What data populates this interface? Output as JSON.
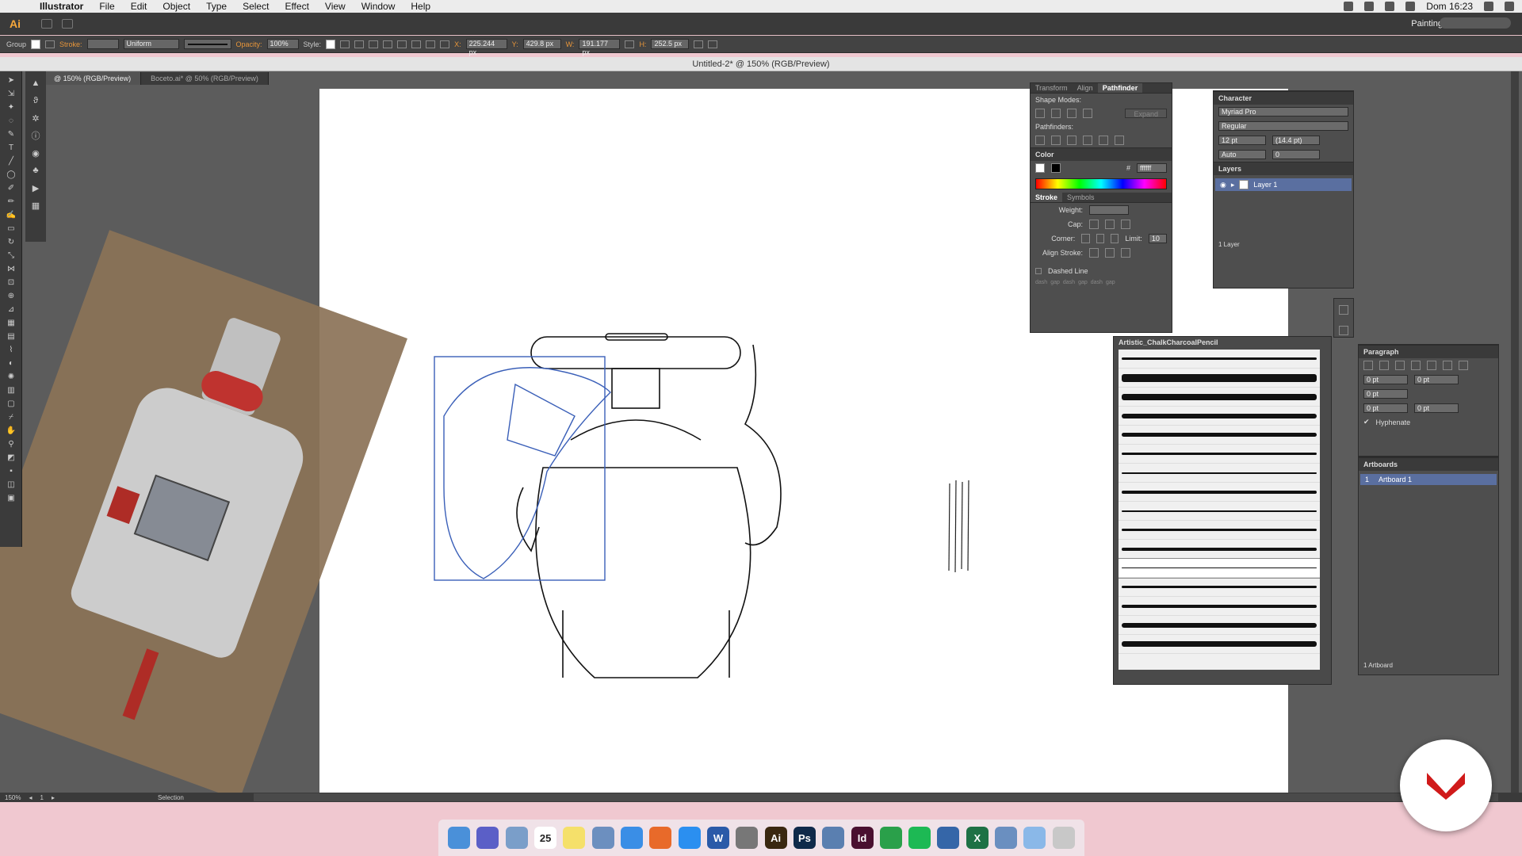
{
  "menubar": {
    "app_name": "Illustrator",
    "items": [
      "File",
      "Edit",
      "Object",
      "Type",
      "Select",
      "Effect",
      "View",
      "Window",
      "Help"
    ],
    "clock": "Dom 16:23"
  },
  "appbar": {
    "logo": "Ai",
    "workspace": "Painting"
  },
  "controlbar": {
    "selection_type": "Group",
    "stroke_label": "Stroke:",
    "uniform_label": "Uniform",
    "opacity_label": "Opacity:",
    "opacity_value": "100%",
    "style_label": "Style:",
    "x_label": "X:",
    "x_value": "225.244 px",
    "y_label": "Y:",
    "y_value": "429.8 px",
    "w_label": "W:",
    "w_value": "191.177 px",
    "h_label": "H:",
    "h_value": "252.5 px"
  },
  "document": {
    "title": "Untitled-2* @ 150% (RGB/Preview)",
    "tabs": [
      {
        "label": "@ 150% (RGB/Preview)",
        "active": true
      },
      {
        "label": "Boceto.ai* @ 50% (RGB/Preview)",
        "active": false
      }
    ]
  },
  "pathfinder_panel": {
    "tabs": [
      "Transform",
      "Align",
      "Pathfinder"
    ],
    "shape_modes_label": "Shape Modes:",
    "expand_label": "Expand",
    "pathfinders_label": "Pathfinders:"
  },
  "color_panel": {
    "title": "Color",
    "hex_symbol": "#",
    "hex_value": "ffffff"
  },
  "stroke_panel": {
    "tabs": [
      "Stroke",
      "Symbols"
    ],
    "weight_label": "Weight:",
    "cap_label": "Cap:",
    "corner_label": "Corner:",
    "limit_label": "Limit:",
    "limit_value": "10",
    "align_label": "Align Stroke:",
    "dashed_label": "Dashed Line",
    "dash_labels": [
      "dash",
      "gap",
      "dash",
      "gap",
      "dash",
      "gap"
    ]
  },
  "character_panel": {
    "title": "Character",
    "font": "Myriad Pro",
    "style": "Regular",
    "size": "12 pt",
    "leading": "(14.4 pt)",
    "kerning": "Auto",
    "tracking": "0"
  },
  "layers_panel": {
    "title": "Layers",
    "layer_name": "Layer 1",
    "count": "1 Layer"
  },
  "brushes_panel": {
    "title": "Artistic_ChalkCharcoalPencil",
    "brush_count": 16
  },
  "paragraph_panel": {
    "title": "Paragraph",
    "indent_values": [
      "0 pt",
      "0 pt",
      "0 pt",
      "0 pt",
      "0 pt"
    ],
    "hyphenate_label": "Hyphenate"
  },
  "artboards_panel": {
    "title": "Artboards",
    "row_index": "1",
    "row_name": "Artboard 1",
    "count": "1 Artboard"
  },
  "statusbar": {
    "zoom": "150%",
    "page": "1",
    "tool": "Selection"
  },
  "dock": {
    "calendar_day": "25",
    "apps": [
      {
        "name": "finder-icon",
        "color": "#4a90d9",
        "label": ""
      },
      {
        "name": "siri-icon",
        "color": "#5b5fc7",
        "label": ""
      },
      {
        "name": "preview-icon",
        "color": "#7a9ec9",
        "label": ""
      },
      {
        "name": "calendar-icon",
        "color": "#ffffff",
        "label": "25"
      },
      {
        "name": "notes-icon",
        "color": "#f5e06a",
        "label": ""
      },
      {
        "name": "photos-icon",
        "color": "#6c8fbf",
        "label": ""
      },
      {
        "name": "safari-icon",
        "color": "#3a8ee6",
        "label": ""
      },
      {
        "name": "firefox-icon",
        "color": "#e86a2a",
        "label": ""
      },
      {
        "name": "appstore-icon",
        "color": "#2b8ff0",
        "label": ""
      },
      {
        "name": "word-icon",
        "color": "#2a5aa8",
        "label": "W"
      },
      {
        "name": "settings-icon",
        "color": "#777777",
        "label": ""
      },
      {
        "name": "illustrator-icon",
        "color": "#3a2810",
        "label": "Ai"
      },
      {
        "name": "photoshop-icon",
        "color": "#0f2a4a",
        "label": "Ps"
      },
      {
        "name": "keynote-icon",
        "color": "#5a7fb0",
        "label": ""
      },
      {
        "name": "indesign-icon",
        "color": "#4a1030",
        "label": "Id"
      },
      {
        "name": "evernote-icon",
        "color": "#2aa04a",
        "label": ""
      },
      {
        "name": "spotify-icon",
        "color": "#1db954",
        "label": ""
      },
      {
        "name": "quicktime-icon",
        "color": "#3566a8",
        "label": ""
      },
      {
        "name": "excel-icon",
        "color": "#1e7145",
        "label": "X"
      },
      {
        "name": "network-icon",
        "color": "#6a8fc0",
        "label": ""
      },
      {
        "name": "downloads-icon",
        "color": "#8ab8e8",
        "label": ""
      },
      {
        "name": "trash-icon",
        "color": "#c8c8c8",
        "label": ""
      }
    ]
  }
}
